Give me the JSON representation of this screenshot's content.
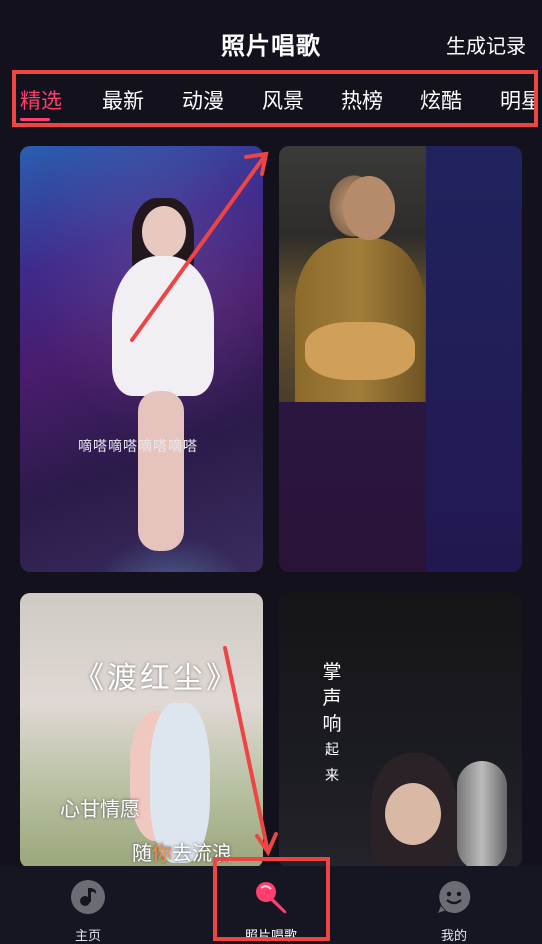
{
  "header": {
    "title": "照片唱歌",
    "records_label": "生成记录"
  },
  "tabs": [
    {
      "label": "精选",
      "active": true
    },
    {
      "label": "最新",
      "active": false
    },
    {
      "label": "动漫",
      "active": false
    },
    {
      "label": "风景",
      "active": false
    },
    {
      "label": "热榜",
      "active": false
    },
    {
      "label": "炫酷",
      "active": false
    },
    {
      "label": "明星",
      "active": false
    }
  ],
  "cards": {
    "card1": {
      "caption": "嘀嗒嘀嗒嘀嗒嘀嗒"
    },
    "card3": {
      "song": "《渡红尘》",
      "lyric1": "心甘情愿",
      "lyric2_prefix": "随",
      "lyric2_highlight": "你",
      "lyric2_suffix": "去流浪"
    },
    "card4": {
      "v1": "掌",
      "v2": "声",
      "v3": "响",
      "v4": "起",
      "v5": "来"
    }
  },
  "bottom_nav": {
    "home": "主页",
    "sing": "照片唱歌",
    "me": "我的"
  },
  "colors": {
    "accent": "#ff3f6e",
    "annotation": "#ef4444",
    "background": "#12111c"
  },
  "icons": {
    "home": "music-note-icon",
    "sing": "microphone-icon",
    "me": "smiley-face-icon"
  }
}
